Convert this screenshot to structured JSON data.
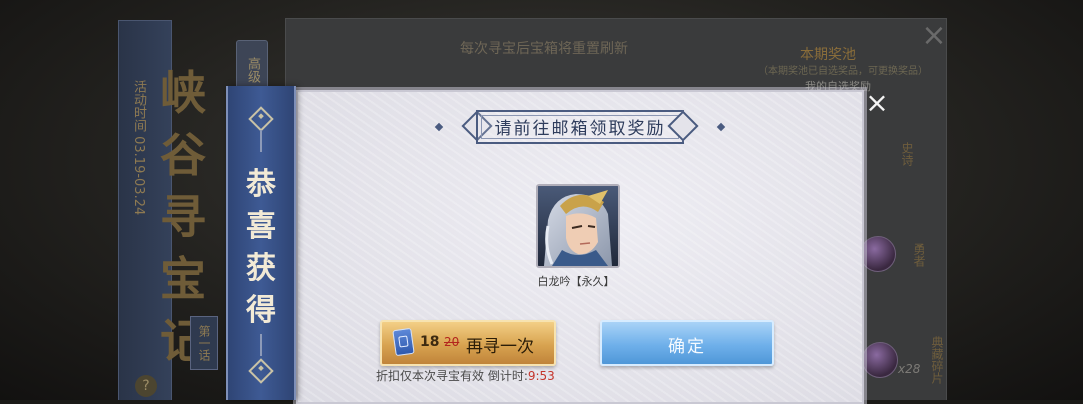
{
  "background": {
    "event_time": "活动时间 03.19-03.24",
    "title": "峡谷寻宝记",
    "tab": "高级",
    "episode": "第一话",
    "help": "?",
    "refresh_notice": "每次寻宝后宝箱将重置刷新",
    "pool_title": "本期奖池",
    "pool_subtitle": "（本期奖池已自选奖品，可更换奖品）",
    "pool_mine": "我的自选奖励",
    "side_labels": [
      "史诗",
      "勇者",
      "典藏碎片"
    ],
    "count": "x28",
    "close_icon": "×"
  },
  "dialog": {
    "banner_text": [
      "恭",
      "喜",
      "获",
      "得"
    ],
    "title": "请前往邮箱领取奖励",
    "reward": {
      "name": "白龙吟【永久】",
      "icon": "hero-portrait"
    },
    "again_button": {
      "price": "18",
      "old_price": "20",
      "label": "再寻一次",
      "icon": "coupon-icon"
    },
    "confirm_button": {
      "label": "确定"
    },
    "note_prefix": "折扣仅本次寻宝有效 倒计时:",
    "countdown": "9:53",
    "close_icon": "×"
  },
  "colors": {
    "banner_blue": "#3e5a94",
    "gold_button": "#d8a350",
    "blue_button": "#6fb0ea",
    "countdown_red": "#c4342b"
  }
}
